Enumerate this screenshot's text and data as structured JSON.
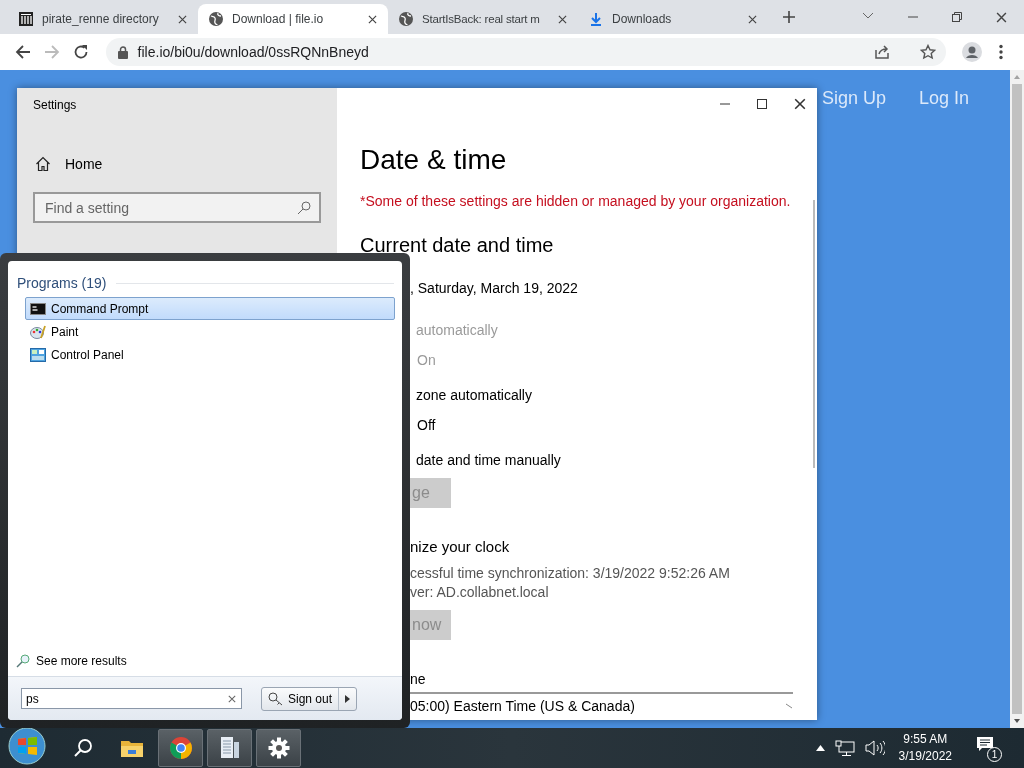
{
  "browser": {
    "tabs": [
      {
        "title": "pirate_renne directory",
        "kind": "building",
        "selected": false
      },
      {
        "title": "Download | file.io",
        "kind": "globe",
        "selected": true
      },
      {
        "title": "StartIsBack: real start m",
        "kind": "globe",
        "selected": false
      },
      {
        "title": "Downloads",
        "kind": "download",
        "selected": false
      }
    ],
    "forward_disabled": true,
    "url": "file.io/bi0u/download/0ssRQNnBneyd"
  },
  "page": {
    "links": [
      "Sign Up",
      "Log In"
    ]
  },
  "settings": {
    "title": "Settings",
    "home": "Home",
    "search_placeholder": "Find a setting",
    "heading": "Date & time",
    "notice": "*Some of these settings are hidden or managed by your organization.",
    "section": "Current date and time",
    "rows": [
      {
        "kind": "text",
        "text": ", Saturday, March 19, 2022",
        "disabled": false
      },
      {
        "kind": "label",
        "text": "automatically",
        "disabled": true
      },
      {
        "kind": "toggle",
        "text": "On",
        "disabled": true
      },
      {
        "kind": "label",
        "text": "zone automatically",
        "disabled": false
      },
      {
        "kind": "toggle",
        "text": "Off",
        "disabled": false
      },
      {
        "kind": "label",
        "text": "date and time manually",
        "disabled": false
      },
      {
        "kind": "button",
        "text": "ge",
        "disabled": true
      },
      {
        "kind": "subheading",
        "text": "nize your clock",
        "disabled": false
      },
      {
        "kind": "info",
        "text": "cessful time synchronization: 3/19/2022 9:52:26 AM"
      },
      {
        "kind": "info",
        "text": "ver: AD.collabnet.local"
      },
      {
        "kind": "button",
        "text": "now",
        "disabled": true
      },
      {
        "kind": "label",
        "text": "ne",
        "disabled": false
      },
      {
        "kind": "dropdown",
        "text": "05:00) Eastern Time (US & Canada)",
        "disabled": false
      }
    ]
  },
  "start_menu": {
    "group": "Programs (19)",
    "programs": [
      {
        "name": "Command Prompt",
        "kind": "cmd",
        "selected": true
      },
      {
        "name": "Paint",
        "kind": "paint",
        "selected": false
      },
      {
        "name": "Control Panel",
        "kind": "control",
        "selected": false
      }
    ],
    "more": "See more results",
    "search_value": "ps",
    "power_button": "Sign out"
  },
  "taskbar": {
    "apps": [
      {
        "kind": "explorer",
        "running": false
      },
      {
        "kind": "chrome",
        "running": true
      },
      {
        "kind": "document",
        "running": true
      },
      {
        "kind": "gear",
        "running": true
      }
    ],
    "time": "9:55 AM",
    "date": "3/19/2022",
    "notifications": "1"
  }
}
